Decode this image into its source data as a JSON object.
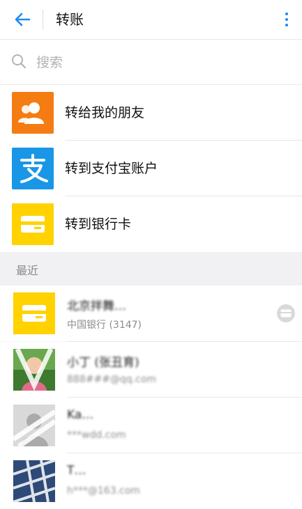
{
  "header": {
    "title": "转账"
  },
  "search": {
    "placeholder": "搜索"
  },
  "menu": [
    {
      "label": "转给我的朋友",
      "color": "#f57c12",
      "icon": "friends-icon"
    },
    {
      "label": "转到支付宝账户",
      "color": "#1996e6",
      "icon": "alipay-icon"
    },
    {
      "label": "转到银行卡",
      "color": "#ffd200",
      "icon": "bank-card-icon"
    }
  ],
  "recent_label": "最近",
  "recent": [
    {
      "name": "北京拌舞…",
      "sub": "中国银行 (3147)",
      "avatar": "bank-card-icon",
      "avatar_color": "#ffd200"
    },
    {
      "name": "小丁 (张丑育)",
      "sub": "888###@qq.com",
      "avatar": "photo"
    },
    {
      "name": "Ka…",
      "sub": "***wdd.com",
      "avatar": "photo"
    },
    {
      "name": "T…",
      "sub": "h***@163.com",
      "avatar": "photo"
    }
  ],
  "colors": {
    "accent": "#1a8cf0"
  }
}
